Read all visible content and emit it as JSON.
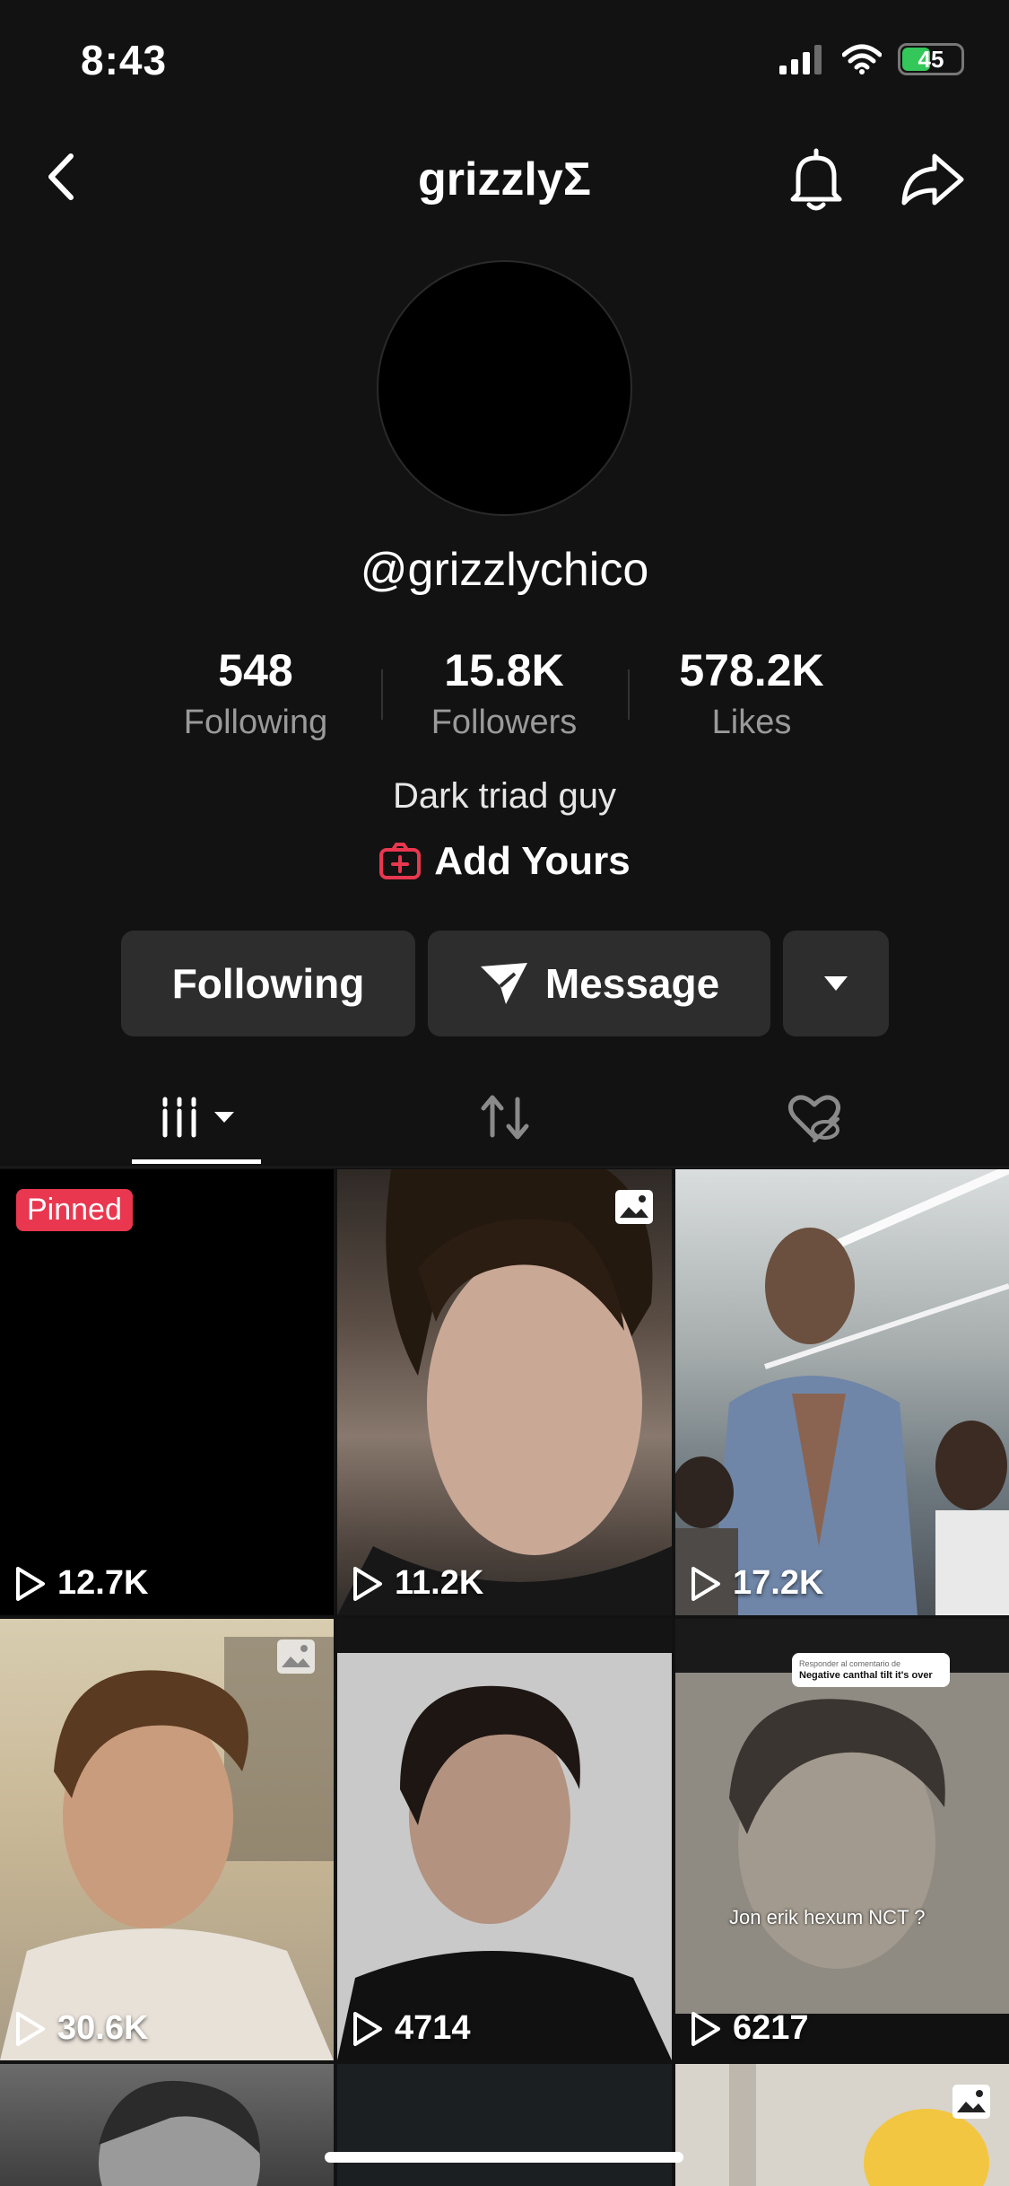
{
  "status": {
    "time": "8:43",
    "battery": "45"
  },
  "nav": {
    "title": "grizzlyΣ"
  },
  "profile": {
    "handle": "@grizzlychico",
    "bio": "Dark triad guy",
    "add_yours": "Add Yours",
    "stats": [
      {
        "value": "548",
        "label": "Following"
      },
      {
        "value": "15.8K",
        "label": "Followers"
      },
      {
        "value": "578.2K",
        "label": "Likes"
      }
    ]
  },
  "actions": {
    "following": "Following",
    "message": "Message"
  },
  "pinned_label": "Pinned",
  "videos": [
    {
      "views": "12.7K",
      "pinned": true
    },
    {
      "views": "11.2K",
      "photo": true
    },
    {
      "views": "17.2K"
    },
    {
      "views": "30.6K",
      "photo": true
    },
    {
      "views": "4714"
    },
    {
      "views": "6217",
      "overlay_small": "Responder al comentario de",
      "overlay_strong": "Negative canthal tilt it's over",
      "caption": "Jon erik hexum NCT ?"
    },
    {
      "views": ""
    },
    {
      "views": ""
    },
    {
      "views": "",
      "photo": true
    }
  ],
  "colors": {
    "accent": "#e8374f",
    "background": "#121212",
    "button": "#2d2d2d"
  }
}
